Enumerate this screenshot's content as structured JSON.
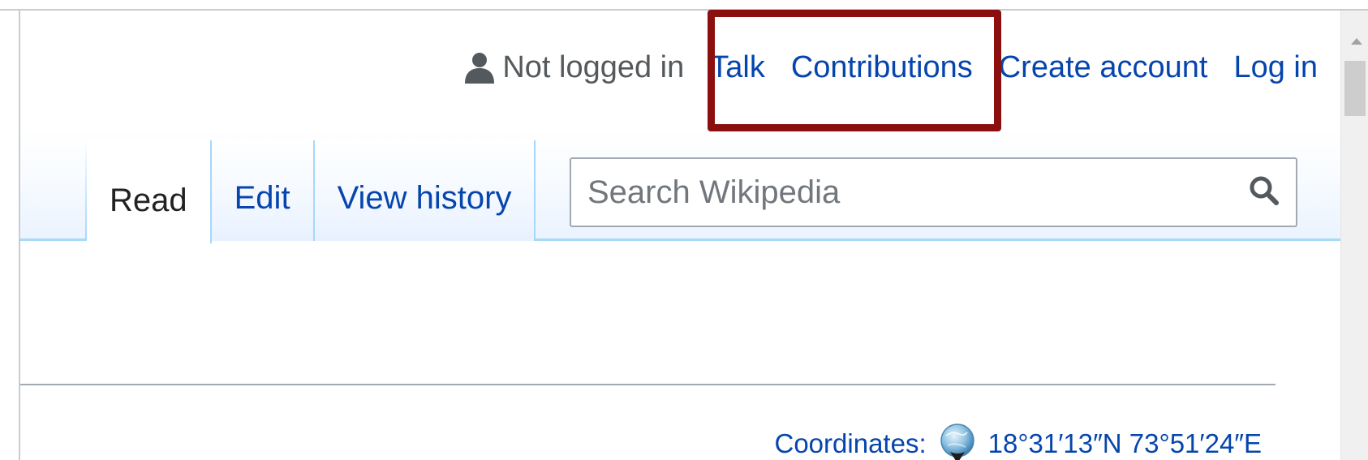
{
  "personal_tools": {
    "icon": "user-icon",
    "anon_label": "Not logged in",
    "talk": "Talk",
    "contributions": "Contributions",
    "create_account": "Create account",
    "log_in": "Log in"
  },
  "tabs": {
    "read": "Read",
    "edit": "Edit",
    "view_history": "View history"
  },
  "search": {
    "placeholder": "Search Wikipedia",
    "icon": "search-icon"
  },
  "coordinates": {
    "label": "Coordinates:",
    "icon": "globe-icon",
    "value": "18°31′13″N 73°51′24″E"
  },
  "colors": {
    "link": "#0645ad",
    "highlight": "#8b0f0f",
    "tab_border": "#a7d7f9"
  }
}
